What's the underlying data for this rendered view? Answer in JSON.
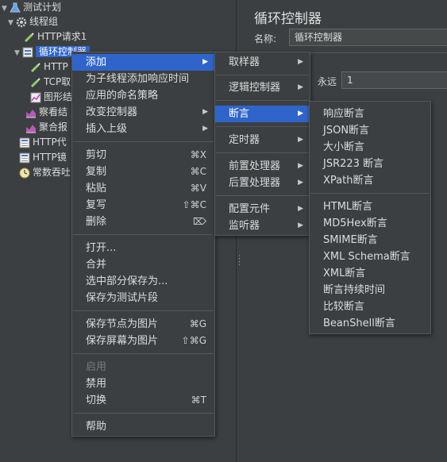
{
  "tree": {
    "items": [
      {
        "label": "测试计划",
        "icon": "flask-icon"
      },
      {
        "label": "线程组",
        "icon": "gear-icon"
      },
      {
        "label": "HTTP请求1",
        "icon": "pipette-icon"
      },
      {
        "label": "循环控制器",
        "icon": "controller-icon"
      },
      {
        "label": "HTTP",
        "icon": "pipette-icon"
      },
      {
        "label": "TCP取",
        "icon": "pipette-icon"
      },
      {
        "label": "图形结",
        "icon": "graph-icon"
      },
      {
        "label": "察看结",
        "icon": "graph-icon"
      },
      {
        "label": "聚合报",
        "icon": "graph-icon"
      },
      {
        "label": "HTTP代",
        "icon": "doc-icon"
      },
      {
        "label": "HTTP镜",
        "icon": "doc-icon"
      },
      {
        "label": "常数吞吐",
        "icon": "timer-icon"
      }
    ]
  },
  "right_panel": {
    "title": "循环控制器",
    "name_label": "名称:",
    "name_value": "循环控制器",
    "forever_label": "永远",
    "loop_value": "1"
  },
  "context_menu": {
    "items": [
      {
        "label": "添加",
        "submenu": true
      },
      {
        "label": "为子线程添加响应时间"
      },
      {
        "label": "应用的命名策略"
      },
      {
        "label": "改变控制器",
        "submenu": true
      },
      {
        "label": "插入上级",
        "submenu": true
      },
      {
        "label": "剪切",
        "shortcut": "⌘X"
      },
      {
        "label": "复制",
        "shortcut": "⌘C"
      },
      {
        "label": "粘贴",
        "shortcut": "⌘V"
      },
      {
        "label": "复写",
        "shortcut": "⇧⌘C"
      },
      {
        "label": "删除",
        "shortcut": "⌦"
      },
      {
        "label": "打开..."
      },
      {
        "label": "合并"
      },
      {
        "label": "选中部分保存为..."
      },
      {
        "label": "保存为测试片段"
      },
      {
        "label": "保存节点为图片",
        "shortcut": "⌘G"
      },
      {
        "label": "保存屏幕为图片",
        "shortcut": "⇧⌘G"
      },
      {
        "label": "启用"
      },
      {
        "label": "禁用"
      },
      {
        "label": "切换",
        "shortcut": "⌘T"
      },
      {
        "label": "帮助"
      }
    ]
  },
  "add_submenu": {
    "items": [
      {
        "label": "取样器"
      },
      {
        "label": "逻辑控制器"
      },
      {
        "label": "断言"
      },
      {
        "label": "定时器"
      },
      {
        "label": "前置处理器"
      },
      {
        "label": "后置处理器"
      },
      {
        "label": "配置元件"
      },
      {
        "label": "监听器"
      }
    ]
  },
  "assertion_submenu": {
    "items": [
      {
        "label": "响应断言"
      },
      {
        "label": "JSON断言"
      },
      {
        "label": "大小断言"
      },
      {
        "label": "JSR223 断言"
      },
      {
        "label": "XPath断言"
      },
      {
        "label": "HTML断言"
      },
      {
        "label": "MD5Hex断言"
      },
      {
        "label": "SMIME断言"
      },
      {
        "label": "XML Schema断言"
      },
      {
        "label": "XML断言"
      },
      {
        "label": "断言持续时间"
      },
      {
        "label": "比较断言"
      },
      {
        "label": "BeanShell断言"
      }
    ]
  },
  "colors": {
    "background": "#3c3f41",
    "highlight": "#2f65ca",
    "text": "#dcdcdc",
    "disabled": "#7a7a7a"
  }
}
